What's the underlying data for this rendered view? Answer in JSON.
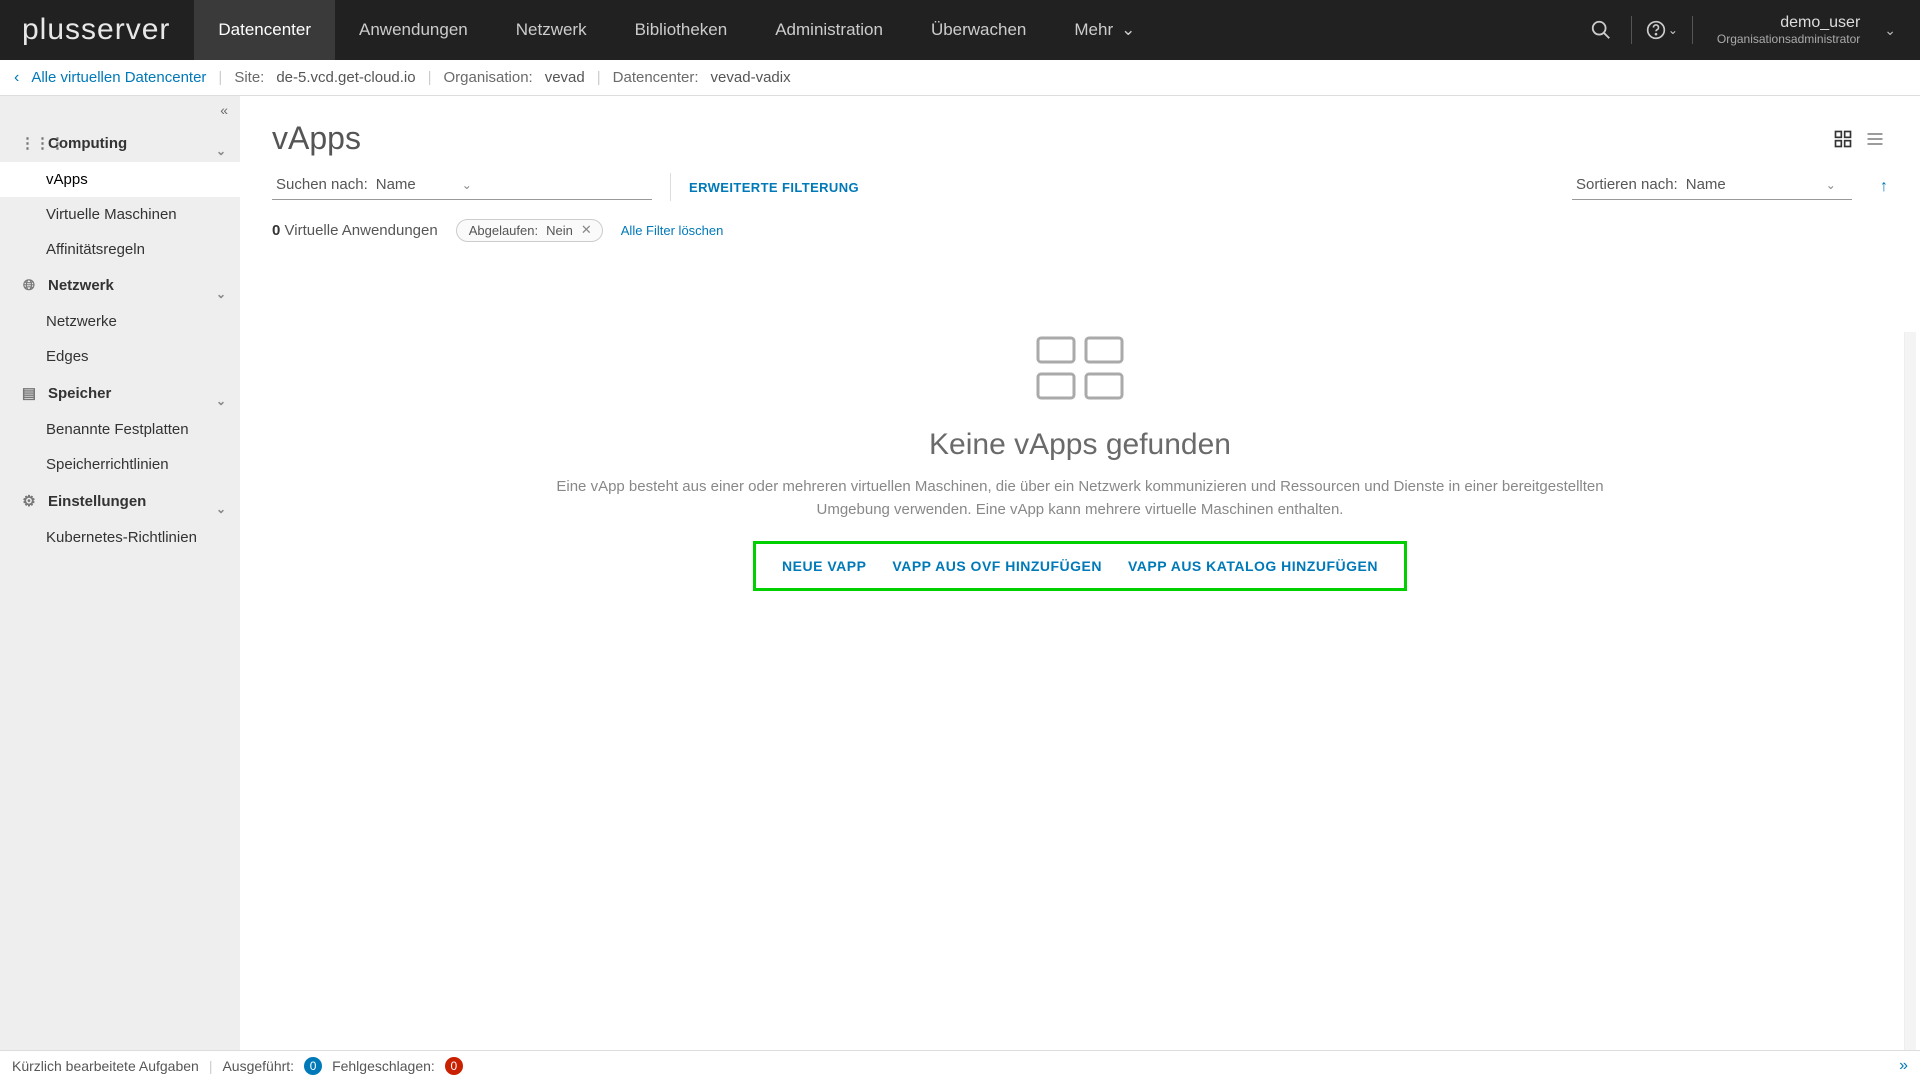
{
  "brand": "plusserver",
  "nav": {
    "items": [
      "Datencenter",
      "Anwendungen",
      "Netzwerk",
      "Bibliotheken",
      "Administration",
      "Überwachen"
    ],
    "more": "Mehr"
  },
  "user": {
    "name": "demo_user",
    "role": "Organisationsadministrator"
  },
  "subhead": {
    "back": "Alle virtuellen Datencenter",
    "site_label": "Site:",
    "site_value": "de-5.vcd.get-cloud.io",
    "org_label": "Organisation:",
    "org_value": "vevad",
    "dc_label": "Datencenter:",
    "dc_value": "vevad-vadix"
  },
  "sidebar": {
    "groups": [
      {
        "title": "Computing",
        "icon": "grid-icon",
        "items": [
          "vApps",
          "Virtuelle Maschinen",
          "Affinitätsregeln"
        ],
        "activeIndex": 0
      },
      {
        "title": "Netzwerk",
        "icon": "globe-icon",
        "items": [
          "Netzwerke",
          "Edges"
        ]
      },
      {
        "title": "Speicher",
        "icon": "storage-icon",
        "items": [
          "Benannte Festplatten",
          "Speicherrichtlinien"
        ]
      },
      {
        "title": "Einstellungen",
        "icon": "gear-icon",
        "items": [
          "Kubernetes-Richtlinien"
        ]
      }
    ]
  },
  "page": {
    "title": "vApps",
    "search_label": "Suchen nach:",
    "search_field": "Name",
    "adv_filter": "ERWEITERTE FILTERUNG",
    "sort_label": "Sortieren nach:",
    "sort_field": "Name",
    "count_number": "0",
    "count_label": "Virtuelle Anwendungen",
    "chip_label": "Abgelaufen:",
    "chip_value": "Nein",
    "clear_filters": "Alle Filter löschen",
    "empty_title": "Keine vApps gefunden",
    "empty_desc": "Eine vApp besteht aus einer oder mehreren virtuellen Maschinen, die über ein Netzwerk kommunizieren und Ressourcen und Dienste in einer bereitgestellten Umgebung verwenden. Eine vApp kann mehrere virtuelle Maschinen enthalten.",
    "actions": [
      "NEUE VAPP",
      "VAPP AUS OVF HINZUFÜGEN",
      "VAPP AUS KATALOG HINZUFÜGEN"
    ]
  },
  "footer": {
    "recent": "Kürzlich bearbeitete Aufgaben",
    "done_label": "Ausgeführt:",
    "done_count": "0",
    "fail_label": "Fehlgeschlagen:",
    "fail_count": "0"
  }
}
